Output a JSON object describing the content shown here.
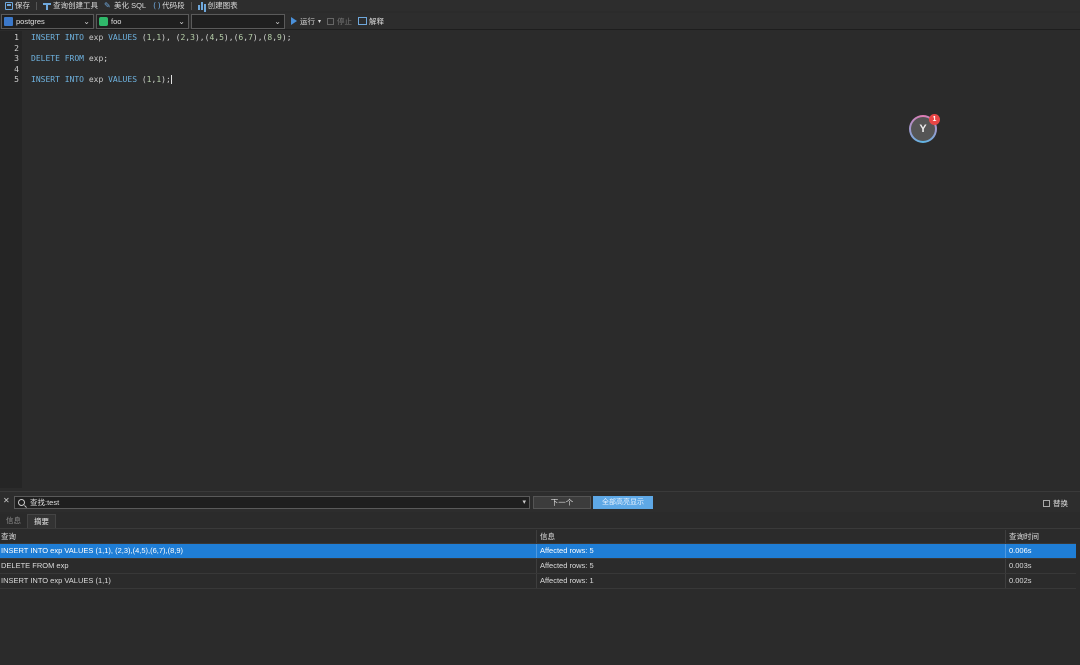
{
  "toolbar": {
    "save": "保存",
    "query_builder": "查询创建工具",
    "beautify_sql": "美化 SQL",
    "code_snippet": "代码段",
    "create_chart": "创建图表"
  },
  "selectors": {
    "connection": "postgres",
    "database": "foo",
    "schema": "",
    "run": "运行",
    "run_arrow": "▾",
    "stop": "停止",
    "explain": "解释"
  },
  "editor": {
    "line_numbers": [
      "1",
      "2",
      "3",
      "4",
      "5"
    ],
    "lines": [
      "INSERT INTO exp VALUES (1,1), (2,3),(4,5),(6,7),(8,9);",
      "",
      "DELETE FROM exp;",
      "",
      "INSERT INTO exp VALUES (1,1);"
    ],
    "badge_count": "1"
  },
  "find": {
    "value": "查找:test",
    "next_button": "下一个",
    "highlight_all_button": "全部高亮显示",
    "replace_label": "替换"
  },
  "result_tabs": [
    "信息",
    "摘要"
  ],
  "results": {
    "columns": [
      "查询",
      "信息",
      "查询时间"
    ],
    "rows": [
      [
        "INSERT INTO exp VALUES (1,1), (2,3),(4,5),(6,7),(8,9)",
        "Affected rows: 5",
        "0.006s"
      ],
      [
        "DELETE FROM exp",
        "Affected rows: 5",
        "0.003s"
      ],
      [
        "INSERT INTO exp VALUES (1,1)",
        "Affected rows: 1",
        "0.002s"
      ]
    ]
  },
  "colors": {
    "accent": "#1f7ed6",
    "keyword": "#6fb3e0",
    "highlight_button": "#5ea8e6",
    "badge": "#e84545"
  }
}
